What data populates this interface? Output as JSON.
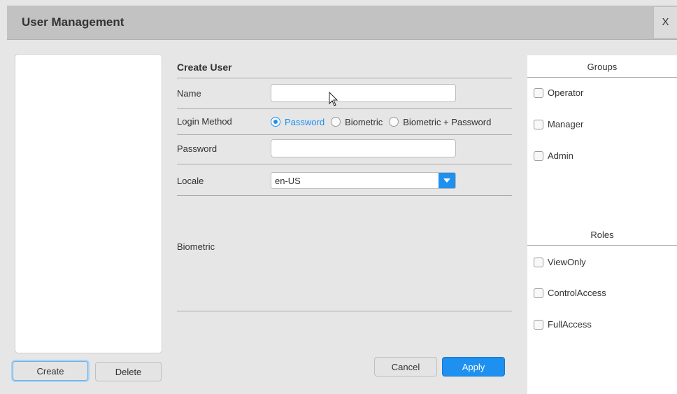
{
  "window": {
    "title": "User Management",
    "close_label": "X"
  },
  "user_list": {
    "create_label": "Create",
    "delete_label": "Delete"
  },
  "form": {
    "title": "Create User",
    "name_label": "Name",
    "name_value": "",
    "login_method_label": "Login Method",
    "login_options": [
      "Password",
      "Biometric",
      "Biometric + Password"
    ],
    "login_selected": "Password",
    "password_label": "Password",
    "password_value": "",
    "locale_label": "Locale",
    "locale_value": "en-US",
    "biometric_label": "Biometric",
    "cancel_label": "Cancel",
    "apply_label": "Apply"
  },
  "groups": {
    "title": "Groups",
    "items": [
      "Operator",
      "Manager",
      "Admin"
    ]
  },
  "roles": {
    "title": "Roles",
    "items": [
      "ViewOnly",
      "ControlAccess",
      "FullAccess"
    ]
  },
  "colors": {
    "accent": "#1e90f0",
    "titlebar": "#c2c2c2",
    "background": "#e6e6e6"
  }
}
